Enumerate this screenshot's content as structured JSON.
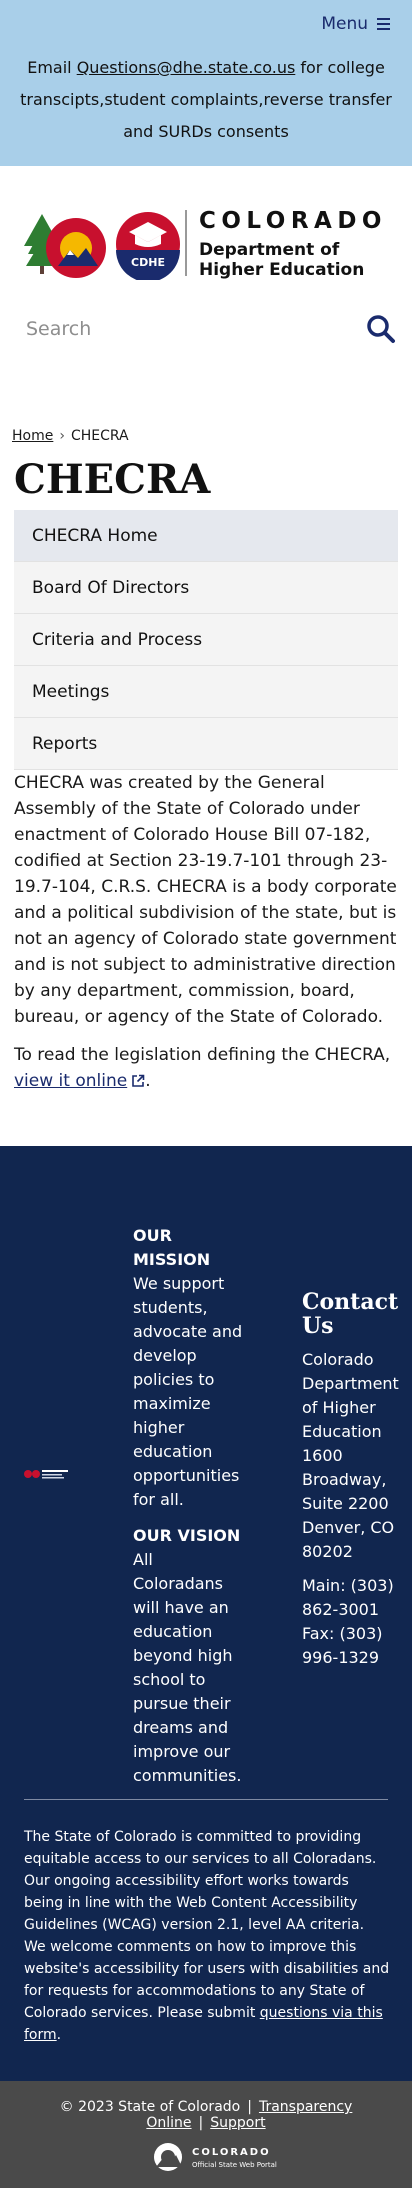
{
  "header": {
    "menu_label": "Menu",
    "alert_prefix": "Email ",
    "alert_email": "Questions@dhe.state.co.us",
    "alert_suffix": " for college transcipts,student complaints,reverse transfer and SURDs consents"
  },
  "logo": {
    "badge_text": "CDHE",
    "title": "COLORADO",
    "subtitle_line1": "Department of",
    "subtitle_line2": "Higher Education"
  },
  "search": {
    "placeholder": "Search"
  },
  "breadcrumb": {
    "home": "Home",
    "separator": "›",
    "current": "CHECRA"
  },
  "page": {
    "title": "CHECRA"
  },
  "side_nav": {
    "items": [
      {
        "label": "CHECRA Home"
      },
      {
        "label": "Board Of Directors"
      },
      {
        "label": "Criteria and Process"
      },
      {
        "label": "Meetings"
      },
      {
        "label": "Reports"
      }
    ]
  },
  "content": {
    "paragraph1": "CHECRA was created by the General Assembly of the State of Colorado under enactment of Colorado House Bill 07-182, codified at Section 23-19.7-101 through 23-19.7-104, C.R.S. CHECRA is a body corporate and a political subdivision of the state, but is not an agency of Colorado state government and is not subject to administrative direction by any department, commission, board, bureau, or agency of the State of Colorado.",
    "paragraph2_prefix": "To read the legislation defining the CHECRA, ",
    "paragraph2_link": "view it online",
    "paragraph2_suffix": "."
  },
  "footer": {
    "mission_title": "OUR MISSION",
    "mission_text": "We support students, advocate and develop policies to maximize higher education opportunities for all.",
    "vision_title": "OUR VISION",
    "vision_text": "All Coloradans will have an education beyond high school to pursue their dreams and improve our communities.",
    "contact_title": "Contact Us",
    "contact_address": "Colorado Department of Higher Education 1600 Broadway, Suite 2200 Denver, CO 80202",
    "contact_main": "Main: (303) 862-3001",
    "contact_fax": "Fax: (303) 996-1329",
    "accessibility_text": "The State of Colorado is committed to providing equitable access to our services to all Coloradans. Our ongoing accessibility effort works towards being in line with the Web Content Accessibility Guidelines (WCAG) version 2.1, level AA criteria. We welcome comments on how to improve this website's accessibility for users with disabilities and for requests for accommodations to any State of Colorado services. Please submit ",
    "accessibility_link": "questions via this form",
    "accessibility_suffix": "."
  },
  "bottom_bar": {
    "copyright": "© 2023 State of Colorado",
    "separator": "|",
    "transparency": "Transparency Online",
    "support": "Support",
    "state_logo_title": "COLORADO",
    "state_logo_sub": "Official State Web Portal"
  },
  "colors": {
    "banner": "#a9cfe9",
    "brand_navy": "#1a2b6d",
    "footer_bg": "#11264f",
    "bottom_bar_bg": "#4a4a4a",
    "cdhe_red": "#c8102e"
  }
}
